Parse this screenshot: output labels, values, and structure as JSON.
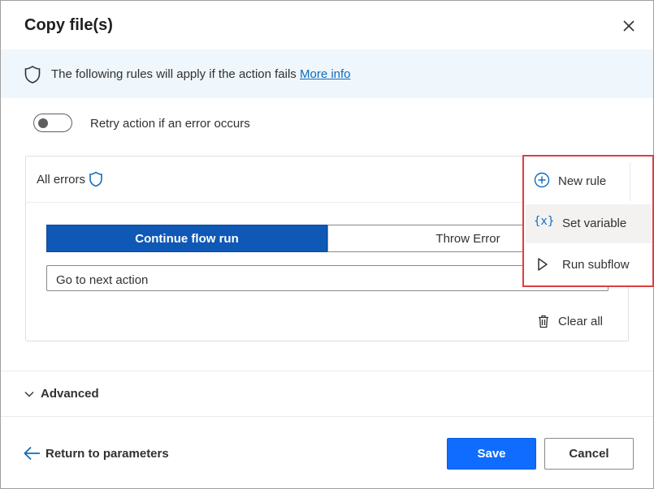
{
  "dialog": {
    "title": "Copy file(s)"
  },
  "banner": {
    "text": "The following rules will apply if the action fails",
    "link": "More info"
  },
  "retry": {
    "label": "Retry action if an error occurs",
    "enabled": false
  },
  "rule": {
    "title": "All errors",
    "tabs": [
      "Continue flow run",
      "Throw Error"
    ],
    "active_tab": "Continue flow run",
    "dropdown_value": "Go to next action",
    "clear_all": "Clear all"
  },
  "menu": {
    "new_rule": "New rule",
    "items": [
      "Set variable",
      "Run subflow"
    ],
    "set_variable_icon_text": "{x}"
  },
  "advanced": {
    "label": "Advanced"
  },
  "footer": {
    "return": "Return to parameters",
    "save": "Save",
    "cancel": "Cancel"
  },
  "colors": {
    "accent": "#0f6cff",
    "active_tab": "#0f58b6",
    "banner_bg": "#eff6fc",
    "highlight_border": "#e03d3d"
  },
  "icons": [
    "close-icon",
    "shield-icon",
    "chevron-down-icon",
    "trash-icon",
    "arrow-left-icon",
    "add-circle-icon",
    "variable-icon",
    "play-icon"
  ]
}
